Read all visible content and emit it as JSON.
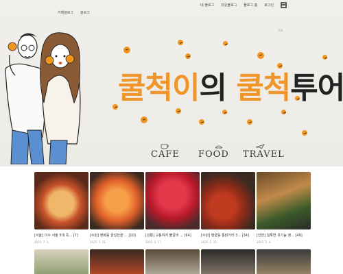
{
  "header": {
    "left_links": [
      "카페블로그",
      "블로그"
    ],
    "right_links": [
      "내 블로그",
      "이웃블로그",
      "블로그 홈",
      "로그인"
    ],
    "menu_icon": "hamburger-icon",
    "small_label": "전체"
  },
  "hero": {
    "title_parts": [
      {
        "text": "쿨척이",
        "color": "orange"
      },
      {
        "text": "의 ",
        "color": "dark"
      },
      {
        "text": "쿨척",
        "color": "orange"
      },
      {
        "text": "투어",
        "color": "dark"
      }
    ],
    "categories": [
      "CAFE",
      "FOOD",
      "TRAVEL"
    ]
  },
  "posts": [
    {
      "title": "[서울] 이수 서울 3대 즉...",
      "count": "[7]",
      "date": "2025. 7. 1."
    },
    {
      "title": "[수원] 영화동 금성잔골 ...",
      "count": "[10]",
      "date": "2025. 5. 31."
    },
    {
      "title": "[강릉] 교동여지 물갈비 ...",
      "count": "[64]",
      "date": "2025. 5. 17."
    },
    {
      "title": "[수원] 행궁동 통닭거리 3...",
      "count": "[34]",
      "date": "2025. 5. 15."
    },
    {
      "title": "[인천] 일룩연 유기농 앵...",
      "count": "[48]",
      "date": "2025. 5. 4."
    }
  ],
  "colors": {
    "accent_orange": "#f0952a",
    "title_dark": "#222222",
    "hero_bg": "#eeece8"
  }
}
